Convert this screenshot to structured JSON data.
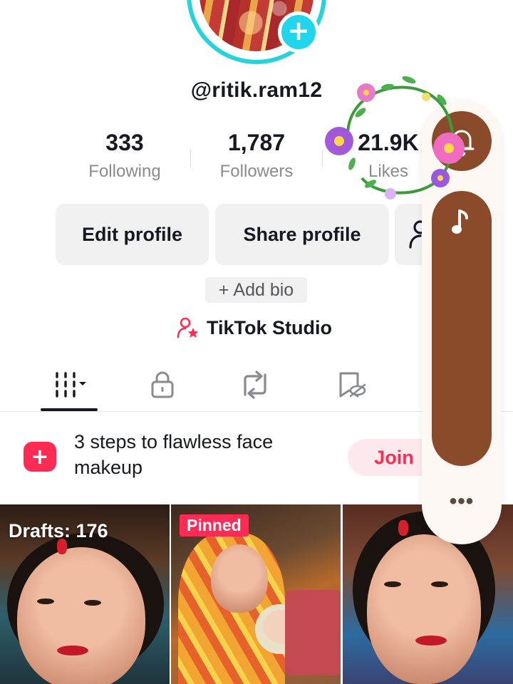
{
  "profile": {
    "username": "@ritik.ram12",
    "add_avatar_glyph": "+"
  },
  "stats": [
    {
      "value": "333",
      "label": "Following"
    },
    {
      "value": "1,787",
      "label": "Followers"
    },
    {
      "value": "21.9K",
      "label": "Likes"
    }
  ],
  "actions": {
    "edit_profile": "Edit profile",
    "share_profile": "Share profile",
    "add_friends_icon": "add-friends-icon"
  },
  "bio": {
    "plus": "+",
    "label": "Add bio"
  },
  "studio": {
    "label": "TikTok Studio",
    "icon": "studio-person-star-icon"
  },
  "tabs": [
    {
      "name": "videos",
      "icon": "grid-bars-icon",
      "selected": true
    },
    {
      "name": "private",
      "icon": "lock-icon",
      "selected": false
    },
    {
      "name": "reposts",
      "icon": "repost-icon",
      "selected": false
    },
    {
      "name": "liked",
      "icon": "hidden-liked-icon",
      "selected": false
    }
  ],
  "promo": {
    "text": "3 steps to flawless face makeup",
    "button": "Join"
  },
  "videos": [
    {
      "overlay": "Drafts: 176"
    },
    {
      "overlay": "Pinned"
    },
    {
      "overlay": ""
    }
  ],
  "floating_panel": {
    "top_icon": "bell-icon",
    "music_icon": "music-note-icon",
    "more_label": "•••"
  },
  "colors": {
    "accent": "#fe2c55",
    "avatar_ring": "#25d3d8",
    "panel_brown": "#8b4a2a"
  }
}
